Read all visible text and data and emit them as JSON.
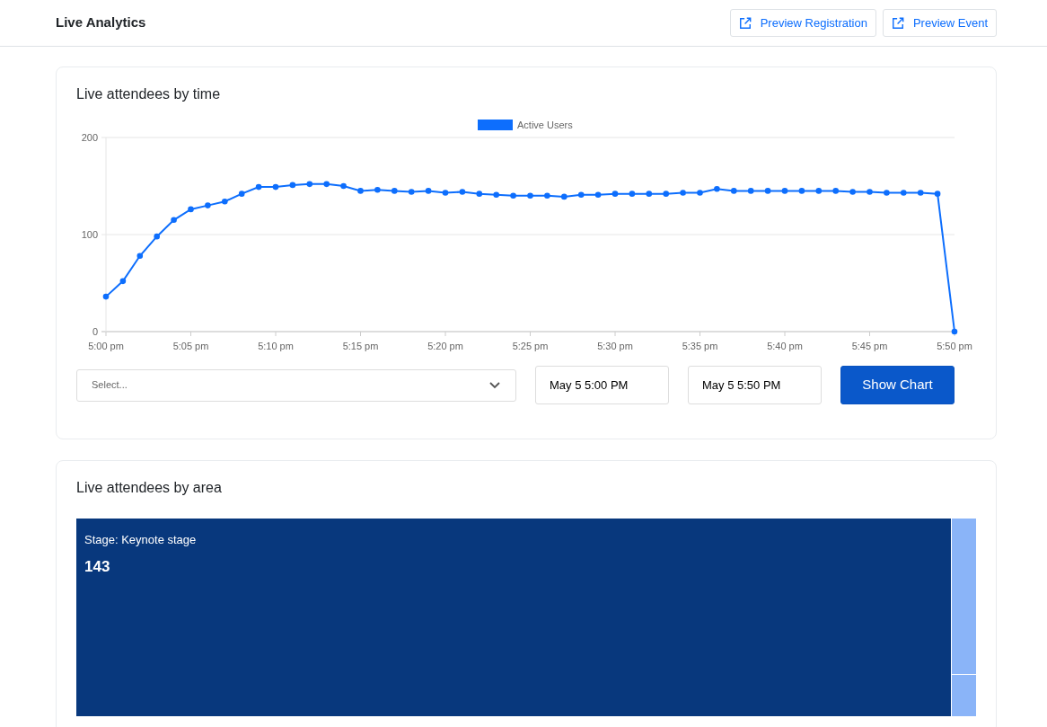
{
  "header": {
    "title": "Live Analytics",
    "buttons": [
      "Preview Registration",
      "Preview Event"
    ]
  },
  "time_card": {
    "title": "Live attendees by time",
    "chart_data": {
      "type": "line",
      "categories": [
        "5:00 pm",
        null,
        null,
        null,
        null,
        "5:05 pm",
        null,
        null,
        null,
        null,
        "5:10 pm",
        null,
        null,
        null,
        null,
        "5:15 pm",
        null,
        null,
        null,
        null,
        "5:20 pm",
        null,
        null,
        null,
        null,
        "5:25 pm",
        null,
        null,
        null,
        null,
        "5:30 pm",
        null,
        null,
        null,
        null,
        "5:35 pm",
        null,
        null,
        null,
        null,
        "5:40 pm",
        null,
        null,
        null,
        null,
        "5:45 pm",
        null,
        null,
        null,
        null,
        "5:50 pm"
      ],
      "series": [
        {
          "name": "Active Users",
          "color": "#0d6efd",
          "marker": true,
          "values": [
            36,
            52,
            78,
            98,
            115,
            126,
            130,
            134,
            142,
            149,
            149,
            151,
            152,
            152,
            150,
            145,
            146,
            145,
            144,
            145,
            143,
            144,
            142,
            141,
            140,
            140,
            140,
            139,
            141,
            141,
            142,
            142,
            142,
            142,
            143,
            143,
            147,
            145,
            145,
            145,
            145,
            145,
            145,
            145,
            144,
            144,
            143,
            143,
            143,
            142,
            0
          ]
        }
      ],
      "ylim": [
        0,
        200
      ],
      "yticks": [
        0,
        100,
        200
      ]
    },
    "select": {
      "placeholder": "Select..."
    },
    "start": "May 5 5:00 PM",
    "end": "May 5 5:50 PM",
    "button": "Show Chart"
  },
  "area_card": {
    "title": "Live attendees by area",
    "tiles": [
      {
        "label": "Stage: Keynote stage",
        "value": "143",
        "color": "#08387d"
      },
      {
        "color": "#8ab4f8"
      },
      {
        "color": "#8ab4f8"
      }
    ]
  }
}
